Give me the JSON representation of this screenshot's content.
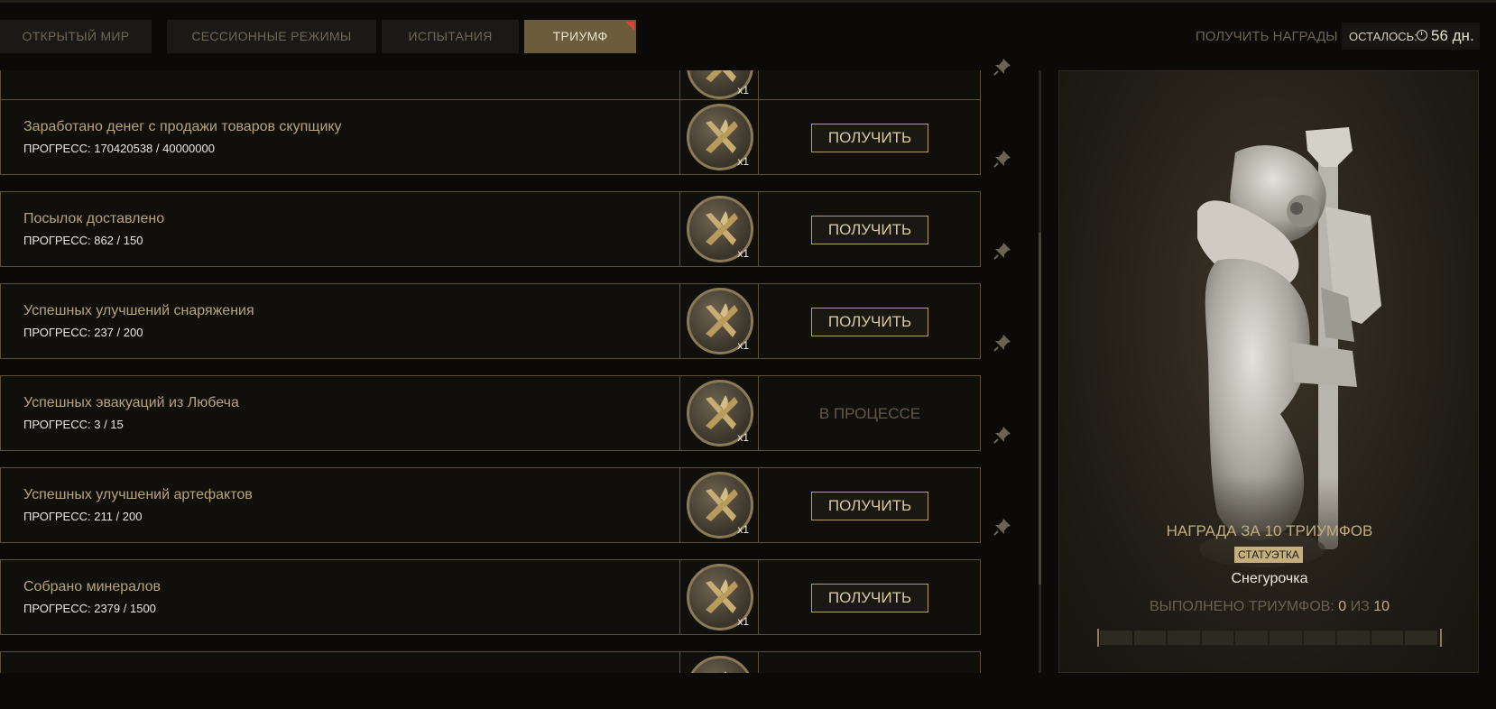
{
  "tabs": [
    {
      "label": "ОТКРЫТЫЙ МИР",
      "active": false
    },
    {
      "label": "СЕССИОННЫЕ РЕЖИМЫ",
      "active": false
    },
    {
      "label": "ИСПЫТАНИЯ",
      "active": false
    },
    {
      "label": "ТРИУМФ",
      "active": true
    }
  ],
  "header": {
    "claim_all": "ПОЛУЧИТЬ НАГРАДЫ",
    "remaining_label": "ОСТАЛОСЬ:",
    "remaining_value": "56 дн."
  },
  "triumphs": [
    {
      "title": "",
      "progress": "",
      "reward_mult": "x1",
      "action": ""
    },
    {
      "title": "Заработано денег с продажи товаров скупщику",
      "progress": "ПРОГРЕСС: 170420538 / 40000000",
      "reward_mult": "x1",
      "action": "ПОЛУЧИТЬ"
    },
    {
      "title": "Посылок доставлено",
      "progress": "ПРОГРЕСС: 862 / 150",
      "reward_mult": "x1",
      "action": "ПОЛУЧИТЬ"
    },
    {
      "title": "Успешных улучшений снаряжения",
      "progress": "ПРОГРЕСС: 237 / 200",
      "reward_mult": "x1",
      "action": "ПОЛУЧИТЬ"
    },
    {
      "title": "Успешных эвакуаций из Любеча",
      "progress": "ПРОГРЕСС: 3 / 15",
      "reward_mult": "x1",
      "status": "В ПРОЦЕССЕ"
    },
    {
      "title": "Успешных улучшений артефактов",
      "progress": "ПРОГРЕСС: 211 / 200",
      "reward_mult": "x1",
      "action": "ПОЛУЧИТЬ"
    },
    {
      "title": "Собрано минералов",
      "progress": "ПРОГРЕСС: 2379 / 1500",
      "reward_mult": "x1",
      "action": "ПОЛУЧИТЬ"
    },
    {
      "title": "",
      "progress": "",
      "reward_mult": "",
      "action": ""
    }
  ],
  "reward_panel": {
    "title": "НАГРАДА ЗА 10 ТРИУМФОВ",
    "badge": "СТАТУЭТКА",
    "name": "Снегурочка",
    "completed_label": "ВЫПОЛНЕНО ТРИУМФОВ:",
    "completed_value": "0",
    "completed_of": "ИЗ",
    "completed_total": "10",
    "progress_fraction": 0
  },
  "colors": {
    "accent": "#c5b07d",
    "active_tab": "#6b5c3c",
    "tab_marker": "#d8463a",
    "border": "#5a5038"
  }
}
